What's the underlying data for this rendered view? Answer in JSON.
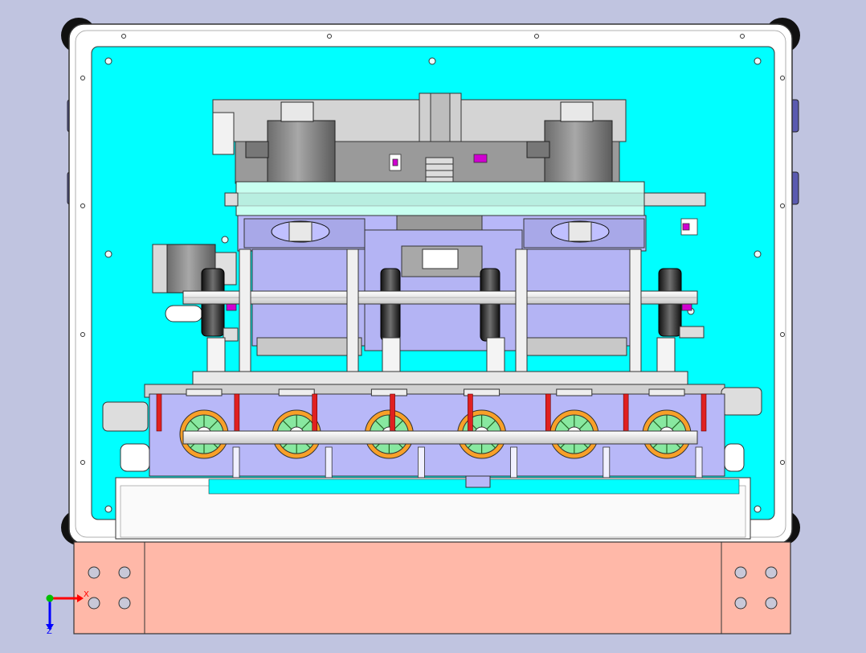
{
  "viewport": {
    "background": "#c0c4e0",
    "model_colors": {
      "panel": "#00ffff",
      "frame": "#ffffff",
      "base": "#ffb8a8",
      "module": "#b8b8f8",
      "gear": "#f8a028",
      "gear_inner": "#88e8a0",
      "red_rod": "#e02020",
      "magenta": "#d000d0",
      "motor": "#888888"
    }
  },
  "triad": {
    "x_label": "X",
    "z_label": "Z",
    "x_color": "#ff0000",
    "y_color": "#00c000",
    "z_color": "#0000ff"
  },
  "assembly": {
    "wheel_count": 6,
    "vertical_rod_count": 6,
    "red_rod_count": 8
  }
}
